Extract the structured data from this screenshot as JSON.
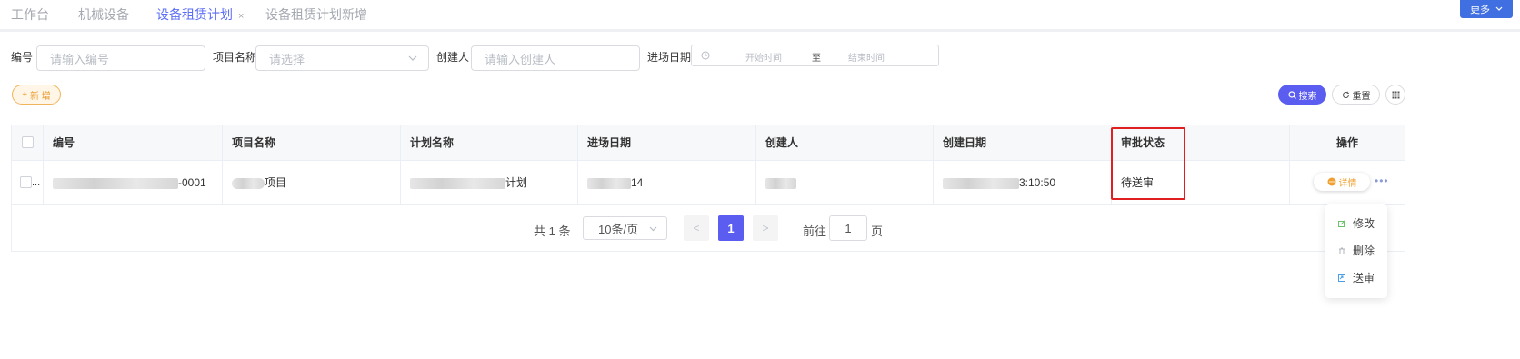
{
  "tabs": [
    {
      "label": "工作台"
    },
    {
      "label": "机械设备"
    },
    {
      "label": "设备租赁计划",
      "close": "×"
    },
    {
      "label": "设备租赁计划新增"
    }
  ],
  "header": {
    "more_label": "更多"
  },
  "filters": {
    "code_label": "编号",
    "code_placeholder": "请输入编号",
    "project_label": "项目名称",
    "project_placeholder": "请选择",
    "creator_label": "创建人",
    "creator_placeholder": "请输入创建人",
    "entry_date_label": "进场日期",
    "start_placeholder": "开始时间",
    "range_sep": "至",
    "end_placeholder": "结束时间"
  },
  "toolbar": {
    "add_label": "新 增",
    "add_icon": "+",
    "search_label": "搜索",
    "reset_label": "重置"
  },
  "table": {
    "headers": [
      "编号",
      "项目名称",
      "计划名称",
      "进场日期",
      "创建人",
      "创建日期",
      "审批状态",
      "操作"
    ],
    "row": {
      "ellipsis": "...",
      "code_suffix": "-0001",
      "project_suffix": "项目",
      "plan_suffix": "计划",
      "date_suffix": "14",
      "created_suffix": "3:10:50",
      "status": "待送审"
    },
    "detail_label": "详情",
    "more_dots": "•••"
  },
  "dropdown": {
    "items": [
      "修改",
      "删除",
      "送审"
    ]
  },
  "pagination": {
    "total": "共 1 条",
    "page_size": "10条/页",
    "prev": "<",
    "current": "1",
    "next": ">",
    "goto_label": "前往",
    "goto_value": "1",
    "page_unit": "页"
  },
  "colors": {
    "accent": "#5b5cf0",
    "warning": "#f0a030",
    "highlight": "#e02020"
  }
}
